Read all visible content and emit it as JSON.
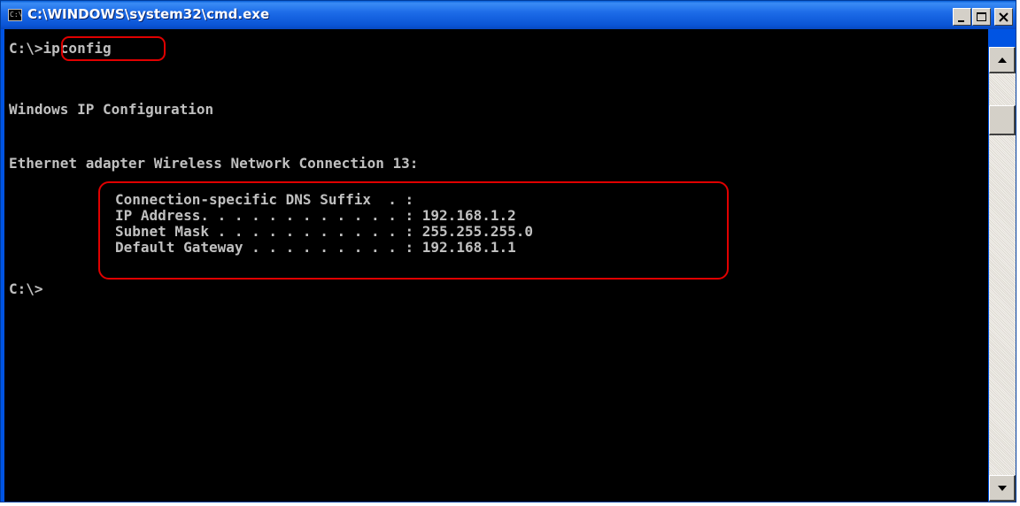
{
  "window": {
    "title": "C:\\WINDOWS\\system32\\cmd.exe",
    "icon_label": "C:\\"
  },
  "console": {
    "prompt_text": "C:\\>",
    "command": "ipconfig",
    "heading": "Windows IP Configuration",
    "adapter": "Ethernet adapter Wireless Network Connection 13:",
    "details": [
      "Connection-specific DNS Suffix  . :",
      "IP Address. . . . . . . . . . . . : 192.168.1.2",
      "Subnet Mask . . . . . . . . . . . : 255.255.255.0",
      "Default Gateway . . . . . . . . . : 192.168.1.1"
    ],
    "final_prompt": "C:\\>"
  },
  "colors": {
    "titlebar": "#0a55d6",
    "console_bg": "#000000",
    "console_text": "#c0c0c0",
    "highlight": "#e00000"
  },
  "icons": [
    "app-icon",
    "minimize-icon",
    "maximize-icon",
    "close-icon",
    "scroll-up-icon",
    "scroll-down-icon"
  ]
}
